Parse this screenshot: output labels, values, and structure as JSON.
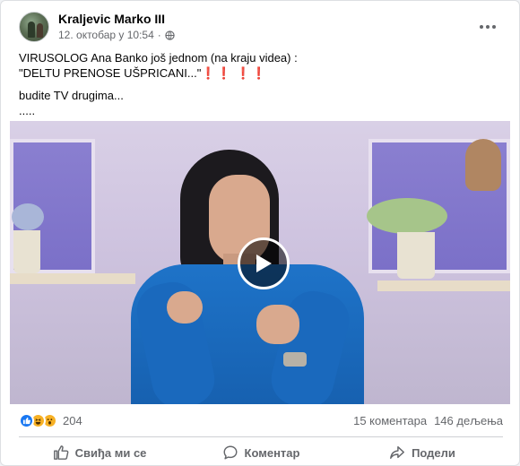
{
  "post": {
    "author": "Kraljevic Marko III",
    "date": "12. октобар у 10:54",
    "separator": "·",
    "privacy_icon": "globe-icon",
    "text_line1": "VIRUSOLOG Ana Banko još jednom (na kraju videa) :",
    "text_line2": "\"DELTU PRENOSE UŠPRICANI...\"",
    "text_line2_emoji": "❗❗ ❗❗",
    "text_line3": "budite TV drugima...",
    "text_line4": ".....",
    "more_icon": "more-options-icon"
  },
  "video": {
    "play_icon": "play-icon"
  },
  "stats": {
    "reaction_icons": [
      "like-icon",
      "haha-icon",
      "wow-icon"
    ],
    "reaction_count": "204",
    "comments": "15 коментара",
    "shares": "146 дељења"
  },
  "actions": {
    "like_label": "Свиђа ми се",
    "comment_label": "Коментар",
    "share_label": "Подели"
  },
  "colors": {
    "accent": "#1877f2",
    "text_secondary": "#65676b",
    "alert_red": "#e41e3f"
  }
}
